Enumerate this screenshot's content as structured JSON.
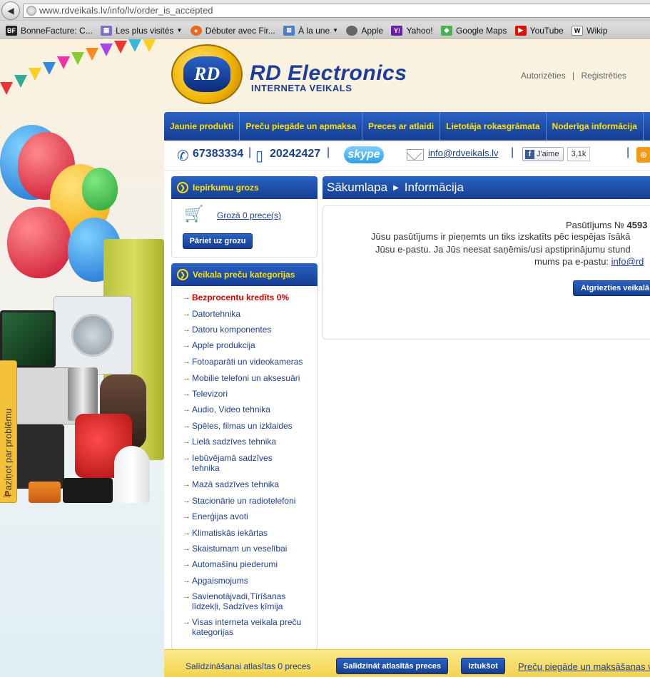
{
  "browser": {
    "url": "www.rdveikals.lv/info/lv/order_is_accepted",
    "bookmarks": [
      {
        "label": "BonneFacture: C...",
        "icon": "bonnefacture-icon"
      },
      {
        "label": "Les plus visités",
        "icon": "most-visited-icon",
        "dropdown": true
      },
      {
        "label": "Débuter avec Fir...",
        "icon": "firefox-icon"
      },
      {
        "label": "À la une",
        "icon": "rss-icon",
        "dropdown": true
      },
      {
        "label": "Apple",
        "icon": "apple-icon"
      },
      {
        "label": "Yahoo!",
        "icon": "yahoo-icon"
      },
      {
        "label": "Google Maps",
        "icon": "google-maps-icon"
      },
      {
        "label": "YouTube",
        "icon": "youtube-icon"
      },
      {
        "label": "Wikip",
        "icon": "wikipedia-icon"
      }
    ]
  },
  "header": {
    "logo_text": "RD",
    "brand": "RD Electronics",
    "brand_sub": "INTERNETA VEIKALS",
    "login": "Autorizēties",
    "separator": "|",
    "register": "Reģistrēties"
  },
  "nav": [
    "Jaunie produkti",
    "Preču piegāde un apmaksa",
    "Preces ar atlaidi",
    "Lietotāja rokasgrāmata",
    "Noderīga informācija"
  ],
  "contact": {
    "phone1": "67383334",
    "phone2": "20242427",
    "skype": "skype",
    "email": "info@rdveikals.lv",
    "fb_like": "J'aime",
    "fb_count": "3,1k",
    "sep": "|"
  },
  "cart": {
    "title": "Iepirkumu grozs",
    "link": "Grozā 0 prece(s)",
    "button": "Pāriet uz grozu"
  },
  "categories": {
    "title": "Veikala preču kategorijas",
    "items": [
      "Bezprocentu kredīts 0%",
      "Datortehnika",
      "Datoru komponentes",
      "Apple produkcija",
      "Fotoaparāti un videokameras",
      "Mobilie telefoni un aksesuāri",
      "Televizori",
      "Audio, Video tehnika",
      "Spēles, filmas un izklaides",
      "Lielā sadzīves tehnika",
      "Iebūvējamā sadzīves tehnika",
      "Mazā sadzīves tehnika",
      "Stacionārie un radiotelefoni",
      "Enerģijas avoti",
      "Klimatiskās iekārtas",
      "Skaistumam un veselībai",
      "Automašīnu piederumi",
      "Apgaismojums",
      "Savienotājvadi,Tīrīšanas līdzekļi, Sadzīves ķīmija",
      "Visas interneta veikala preču kategorijas"
    ]
  },
  "breadcrumb": {
    "home": "Sākumlapa",
    "current": "Informācija"
  },
  "message": {
    "line1_prefix": "Pasūtījums №",
    "order_no": "4593",
    "line2": "Jūsu pasūtījums ir pieņemts un tiks izskatīts pēc iespējas īsākā",
    "line3": "Jūsu e-pastu. Ja Jūs neesat saņēmis/usi apstiprinājumu stund",
    "line4_prefix": "mums pa e-pastu:",
    "line4_link": "info@rd",
    "back_button": "Atgriezties veikalā"
  },
  "feedback_tab": "Paziņot par problēmu",
  "compare_bar": {
    "text": "Salīdzināšanai atlasītas 0 preces",
    "compare_button": "Salīdzināt atlasītās preces",
    "clear_button": "Iztukšot",
    "shipping_link": "Preču piegāde un maksāšanas v"
  },
  "colors": {
    "accent_blue": "#1c3f8f",
    "nav_blue": "#2a62c4",
    "nav_text_yellow": "#ffe100",
    "hot_red": "#dd0000",
    "bottom_bar_yellow": "#f4d44f"
  }
}
